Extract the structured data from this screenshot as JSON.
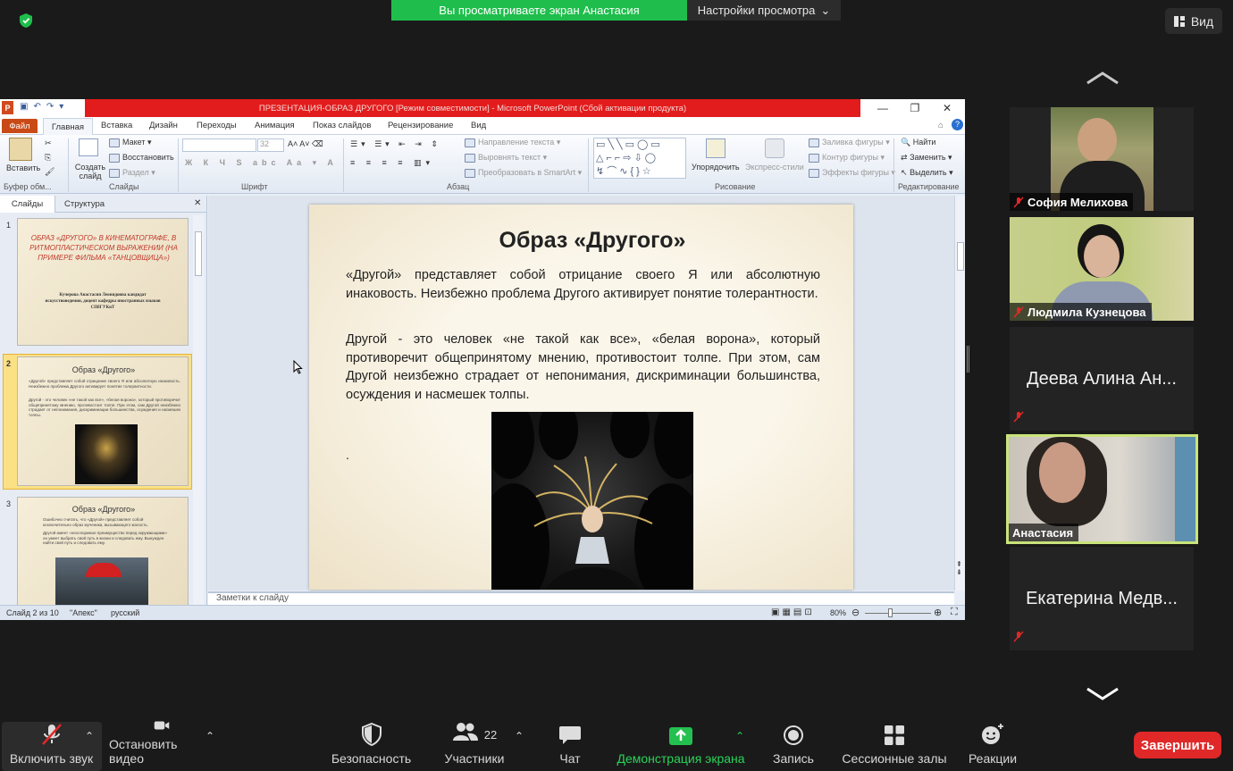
{
  "zoom": {
    "banner_text": "Вы просматриваете экран Анастасия",
    "view_settings_label": "Настройки просмотра",
    "view_button_label": "Вид",
    "accent_green": "#1fbe4c",
    "end_button_color": "#e02828"
  },
  "ppt": {
    "window_title": "ПРЕЗЕНТАЦИЯ-ОБРАЗ ДРУГОГО [Режим совместимости] - Microsoft PowerPoint (Сбой активации продукта)",
    "tabs": [
      "Файл",
      "Главная",
      "Вставка",
      "Дизайн",
      "Переходы",
      "Анимация",
      "Показ слайдов",
      "Рецензирование",
      "Вид"
    ],
    "ribbon": {
      "paste": "Вставить",
      "create_slide": "Создать слайд",
      "layout": "Макет",
      "restore": "Восстановить",
      "section": "Раздел",
      "font_size": "32",
      "text_direction": "Направление текста",
      "align_text": "Выровнять текст",
      "convert_smartart": "Преобразовать в SmartArt",
      "arrange": "Упорядочить",
      "quick_styles": "Экспресс-стили",
      "shape_fill": "Заливка фигуры",
      "shape_outline": "Контур фигуры",
      "shape_effects": "Эффекты фигуры",
      "find": "Найти",
      "replace": "Заменить",
      "select": "Выделить",
      "groups": [
        "Буфер обм...",
        "Слайды",
        "Шрифт",
        "Абзац",
        "Рисование",
        "Редактирование"
      ]
    },
    "panel_tabs": [
      "Слайды",
      "Структура"
    ],
    "thumbnails": [
      {
        "num": "1",
        "title": "ОБРАЗ «ДРУГОГО» В КИНЕМАТОГРАФЕ, В РИТМОПЛАСТИЧЕСКОМ ВЫРАЖЕНИИ (НА ПРИМЕРЕ ФИЛЬМА «ТАНЦОВЩИЦА»)",
        "author": "Кучерова Анастасия Леонидовна кандидат искусствоведения, доцент кафедры иностранных языков СПбГУКиТ"
      },
      {
        "num": "2",
        "title": "Образ «Другого»"
      },
      {
        "num": "3",
        "title": "Образ «Другого»",
        "text1": "Ошибочно считать, что «Другой» представляет собой исключительно образ мученика, вызывающего жалость.",
        "text2": "Другой имеет «неоспоримое преимущество перед окружающими» он умеет выбрать свой путь в жизни и следовать ему. Вынужден найти свой путь и следовать ему."
      }
    ],
    "slide": {
      "title": "Образ «Другого»",
      "paragraph1": "«Другой» представляет собой отрицание своего Я или абсолютную инаковость. Неизбежно проблема Другого активирует понятие толерантности.",
      "paragraph2": "Другой  - это человек «не такой как все», «белая ворона», который противоречит общепринятому мнению,  противостоит толпе. При этом, сам Другой неизбежно страдает от непонимания, дискриминации большинства, осуждения и насмешек толпы.",
      "dot": "."
    },
    "notes_placeholder": "Заметки к слайду",
    "status": {
      "slide_info": "Слайд 2 из 10",
      "theme": "\"Апекс\"",
      "language": "русский",
      "zoom": "80%"
    }
  },
  "participants": [
    {
      "name": "София Мелихова",
      "muted": true,
      "video": true
    },
    {
      "name": "Людмила Кузнецова",
      "muted": true,
      "video": true
    },
    {
      "name": "Деева Алина Ан...",
      "muted": true,
      "video": false
    },
    {
      "name": "Анастасия",
      "muted": false,
      "video": true,
      "active_speaker": true
    },
    {
      "name": "Екатерина Медв...",
      "muted": true,
      "video": false
    }
  ],
  "toolbar": {
    "unmute": "Включить звук",
    "stop_video": "Остановить видео",
    "security": "Безопасность",
    "participants": "Участники",
    "participants_count": "22",
    "chat": "Чат",
    "share": "Демонстрация экрана",
    "record": "Запись",
    "breakout": "Сессионные залы",
    "reactions": "Реакции",
    "end": "Завершить"
  }
}
